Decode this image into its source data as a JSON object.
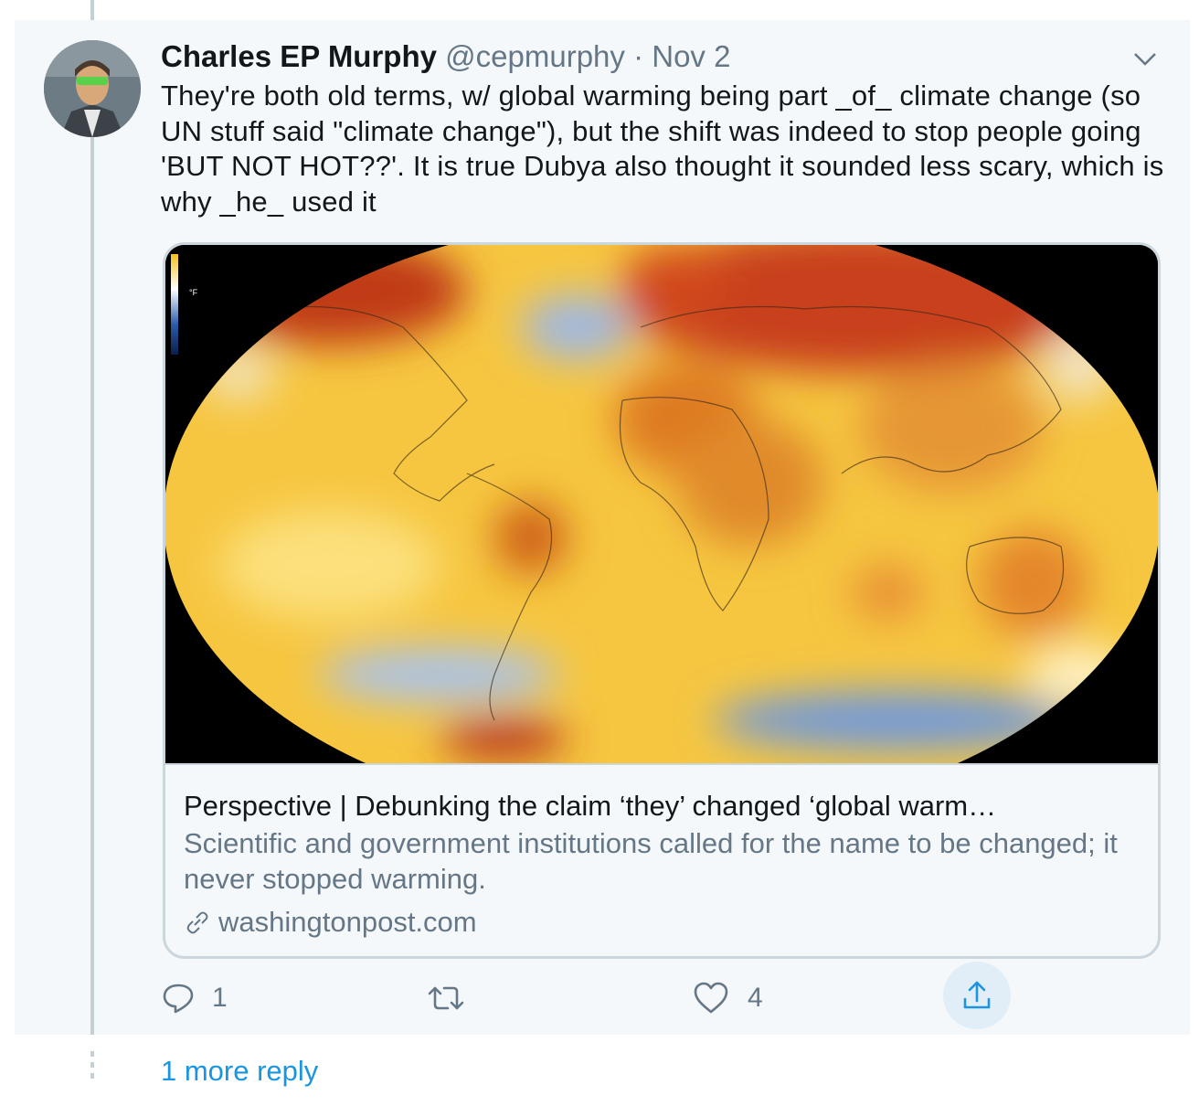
{
  "tweet": {
    "author_name": "Charles EP Murphy",
    "handle": "@cepmurphy",
    "separator": "·",
    "date": "Nov 2",
    "text": "They're both old terms, w/ global warming being part _of_ climate change (so UN stuff said \"climate change\"), but the shift was indeed to stop people going 'BUT NOT HOT??'. It is true Dubya also thought it sounded less scary, which is why _he_ used it"
  },
  "card": {
    "image_legend_unit": "°F",
    "title": "Perspective | Debunking the claim ‘they’ changed ‘global warm…",
    "description": "Scientific and government institutions called for the name to be changed; it never stopped warming.",
    "domain": "washingtonpost.com"
  },
  "actions": {
    "reply_count": "1",
    "like_count": "4"
  },
  "thread": {
    "more_replies_label": "1 more reply"
  },
  "colors": {
    "accent": "#1b95e0",
    "secondary_text": "#657786",
    "border": "#ccd6dd",
    "background": "#f5f8fa"
  },
  "icons": [
    "caret-down-icon",
    "link-icon",
    "reply-icon",
    "retweet-icon",
    "like-icon",
    "share-icon"
  ]
}
